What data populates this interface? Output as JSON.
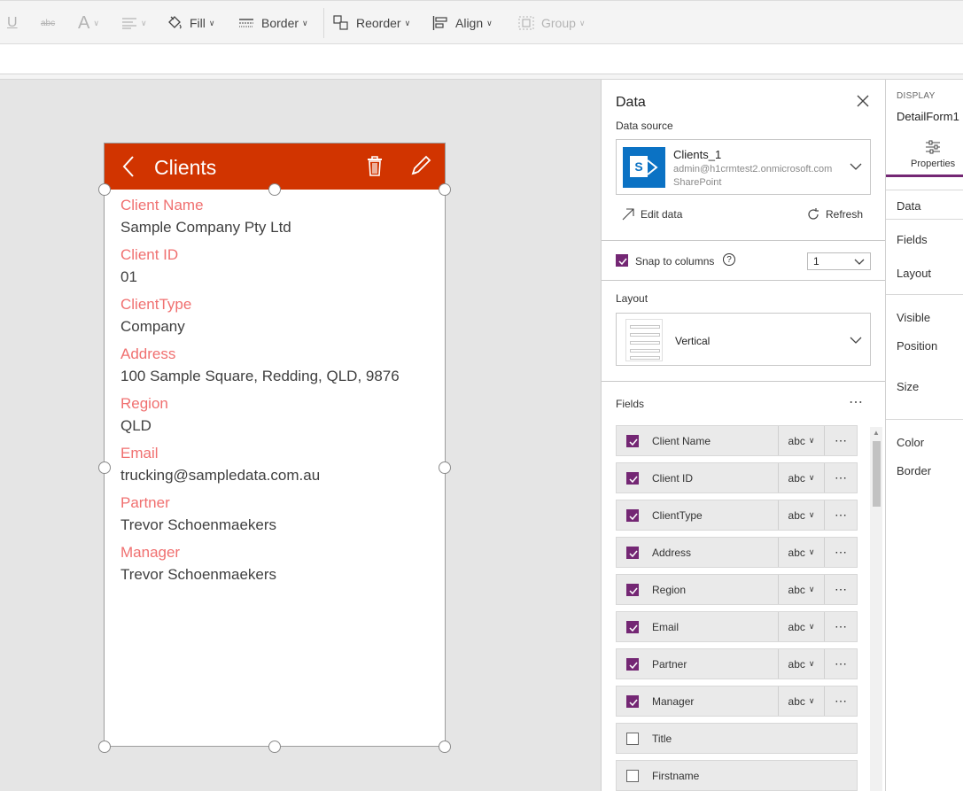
{
  "toolbar": {
    "fill_label": "Fill",
    "border_label": "Border",
    "reorder_label": "Reorder",
    "align_label": "Align",
    "group_label": "Group",
    "font_color_glyph": "A",
    "underline_glyph": "U",
    "strikethrough_glyph": "abc"
  },
  "screen": {
    "title": "Clients",
    "header_color": "#d13400",
    "fields": [
      {
        "label": "Client Name",
        "value": "Sample Company Pty Ltd"
      },
      {
        "label": "Client ID",
        "value": "01"
      },
      {
        "label": "ClientType",
        "value": "Company"
      },
      {
        "label": "Address",
        "value": "100 Sample Square, Redding, QLD, 9876"
      },
      {
        "label": "Region",
        "value": "QLD"
      },
      {
        "label": "Email",
        "value": "trucking@sampledata.com.au"
      },
      {
        "label": "Partner",
        "value": "Trevor Schoenmaekers"
      },
      {
        "label": "Manager",
        "value": "Trevor Schoenmaekers"
      }
    ]
  },
  "data_panel": {
    "title": "Data",
    "data_source_label": "Data source",
    "source": {
      "name": "Clients_1",
      "account": "admin@h1crmtest2.onmicrosoft.com",
      "type": "SharePoint",
      "logo_letter": "S"
    },
    "edit_data_label": "Edit data",
    "refresh_label": "Refresh",
    "snap_label": "Snap to columns",
    "snap_checked": true,
    "help_glyph": "?",
    "columns_value": "1",
    "layout_label": "Layout",
    "layout_value": "Vertical",
    "fields_label": "Fields",
    "field_rows": [
      {
        "name": "Client Name",
        "checked": true,
        "type": "abc"
      },
      {
        "name": "Client ID",
        "checked": true,
        "type": "abc"
      },
      {
        "name": "ClientType",
        "checked": true,
        "type": "abc"
      },
      {
        "name": "Address",
        "checked": true,
        "type": "abc"
      },
      {
        "name": "Region",
        "checked": true,
        "type": "abc"
      },
      {
        "name": "Email",
        "checked": true,
        "type": "abc"
      },
      {
        "name": "Partner",
        "checked": true,
        "type": "abc"
      },
      {
        "name": "Manager",
        "checked": true,
        "type": "abc"
      },
      {
        "name": "Title",
        "checked": false
      },
      {
        "name": "Firstname",
        "checked": false
      }
    ]
  },
  "props_panel": {
    "kicker": "DISPLAY",
    "control_name": "DetailForm1",
    "tab_label": "Properties",
    "accent_color": "#742774",
    "items": [
      "Data",
      "Fields",
      "Layout",
      "Visible",
      "Position",
      "Size",
      "Color",
      "Border"
    ]
  }
}
